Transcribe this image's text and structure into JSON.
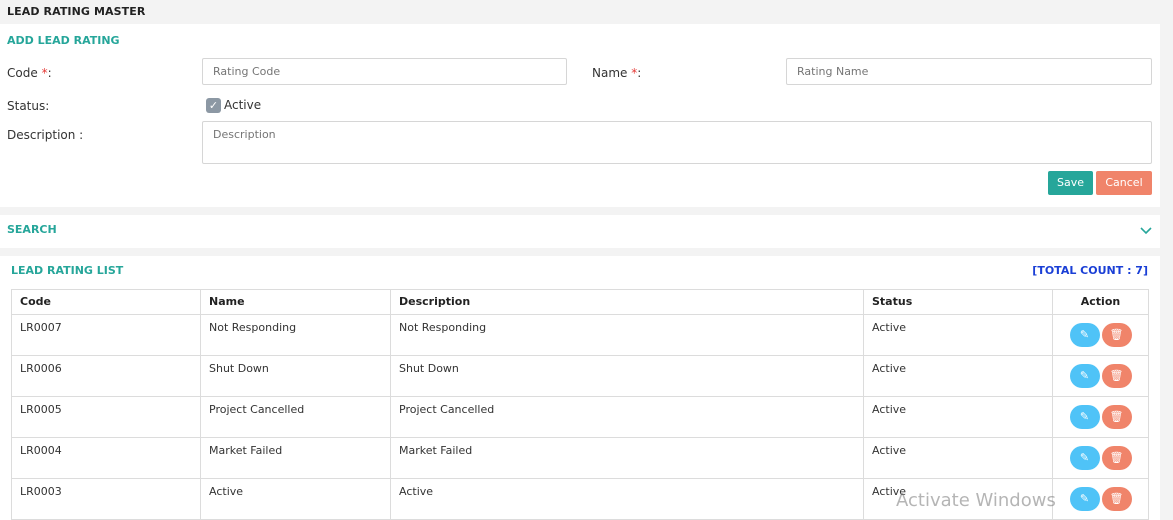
{
  "page": {
    "title": "LEAD RATING MASTER"
  },
  "add_panel": {
    "heading": "ADD LEAD RATING",
    "code_label": "Code",
    "code_placeholder": "Rating Code",
    "name_label": "Name",
    "name_placeholder": "Rating Name",
    "required_mark": "*",
    "label_suffix": ":",
    "status_label": "Status:",
    "active_label": "Active",
    "active_checked": true,
    "description_label": "Description :",
    "description_placeholder": "Description",
    "save_label": "Save",
    "cancel_label": "Cancel"
  },
  "search_panel": {
    "heading": "SEARCH"
  },
  "list_panel": {
    "heading": "LEAD RATING LIST",
    "total_count": "[TOTAL COUNT : 7]",
    "columns": [
      "Code",
      "Name",
      "Description",
      "Status",
      "Action"
    ],
    "rows": [
      {
        "code": "LR0007",
        "name": "Not Responding",
        "description": "Not Responding",
        "status": "Active"
      },
      {
        "code": "LR0006",
        "name": "Shut Down",
        "description": "Shut Down",
        "status": "Active"
      },
      {
        "code": "LR0005",
        "name": "Project Cancelled",
        "description": "Project Cancelled",
        "status": "Active"
      },
      {
        "code": "LR0004",
        "name": "Market Failed",
        "description": "Market Failed",
        "status": "Active"
      },
      {
        "code": "LR0003",
        "name": "Active",
        "description": "Active",
        "status": "Active"
      }
    ]
  },
  "overlay": {
    "watermark": "Activate Windows"
  },
  "colors": {
    "accent": "#26a69a",
    "cancel": "#f0846a",
    "edit": "#4fc3f7",
    "count": "#1a3fd6"
  },
  "icons": {
    "edit": "pencil-icon",
    "delete": "trash-icon",
    "expand": "chevron-down-icon",
    "check": "check-icon"
  }
}
